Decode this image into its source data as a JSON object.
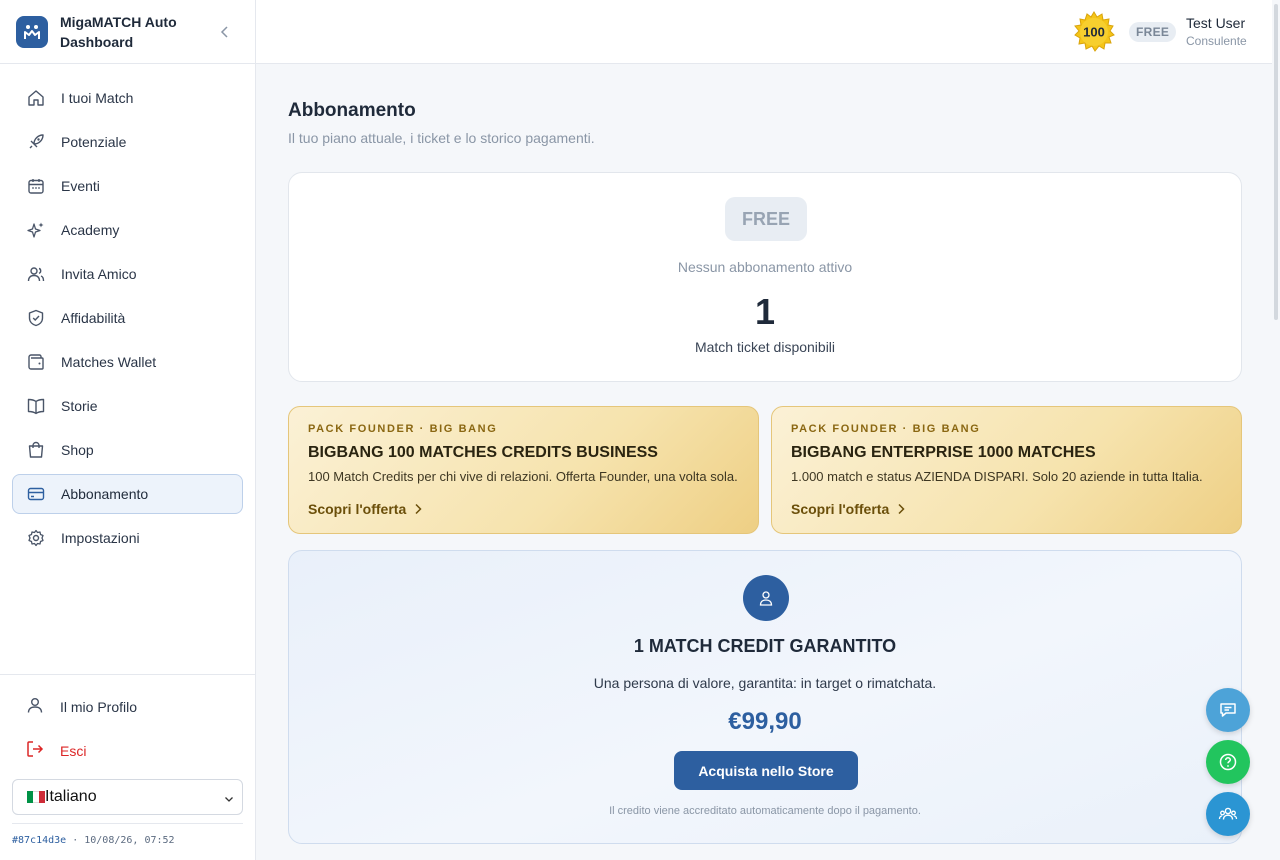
{
  "app": {
    "name": "MigaMATCH Auto Dashboard"
  },
  "sidebar": {
    "items": [
      {
        "label": "I tuoi Match",
        "icon": "home-icon"
      },
      {
        "label": "Potenziale",
        "icon": "rocket-icon"
      },
      {
        "label": "Eventi",
        "icon": "calendar-icon"
      },
      {
        "label": "Academy",
        "icon": "sparkles-icon"
      },
      {
        "label": "Invita Amico",
        "icon": "users-icon"
      },
      {
        "label": "Affidabilità",
        "icon": "shield-check-icon"
      },
      {
        "label": "Matches Wallet",
        "icon": "wallet-icon"
      },
      {
        "label": "Storie",
        "icon": "book-icon"
      },
      {
        "label": "Shop",
        "icon": "shopping-bag-icon"
      },
      {
        "label": "Abbonamento",
        "icon": "credit-card-icon",
        "active": true
      },
      {
        "label": "Impostazioni",
        "icon": "gear-icon"
      }
    ],
    "profile_label": "Il mio Profilo",
    "logout_label": "Esci",
    "language": "Italiano",
    "version_hash": "#87c14d3e",
    "version_date": " · 10/08/26, 07:52"
  },
  "header": {
    "coin_value": "100",
    "plan_badge": "FREE",
    "user_name": "Test User",
    "user_role": "Consulente"
  },
  "page": {
    "title": "Abbonamento",
    "subtitle": "Il tuo piano attuale, i ticket e lo storico pagamenti."
  },
  "plan_card": {
    "plan": "FREE",
    "status": "Nessun abbonamento attivo",
    "tickets": "1",
    "tickets_label": "Match ticket disponibili"
  },
  "offers": [
    {
      "kicker": "PACK FOUNDER · BIG BANG",
      "title": "BIGBANG 100 MATCHES CREDITS BUSINESS",
      "description": "100 Match Credits per chi vive di relazioni. Offerta Founder, una volta sola.",
      "link": "Scopri l'offerta"
    },
    {
      "kicker": "PACK FOUNDER · BIG BANG",
      "title": "BIGBANG ENTERPRISE 1000 MATCHES",
      "description": "1.000 match e status AZIENDA DISPARI. Solo 20 aziende in tutta Italia.",
      "link": "Scopri l'offerta"
    }
  ],
  "guarantee": {
    "title": "1 MATCH CREDIT GARANTITO",
    "description": "Una persona di valore, garantita: in target o rimatchata.",
    "price": "€99,90",
    "button": "Acquista nello Store",
    "note": "Il credito viene accreditato automaticamente dopo il pagamento."
  },
  "colors": {
    "primary": "#2d5fa0",
    "gold": "#eecf84",
    "logout": "#dc2626",
    "help_fab": "#22c55e"
  }
}
